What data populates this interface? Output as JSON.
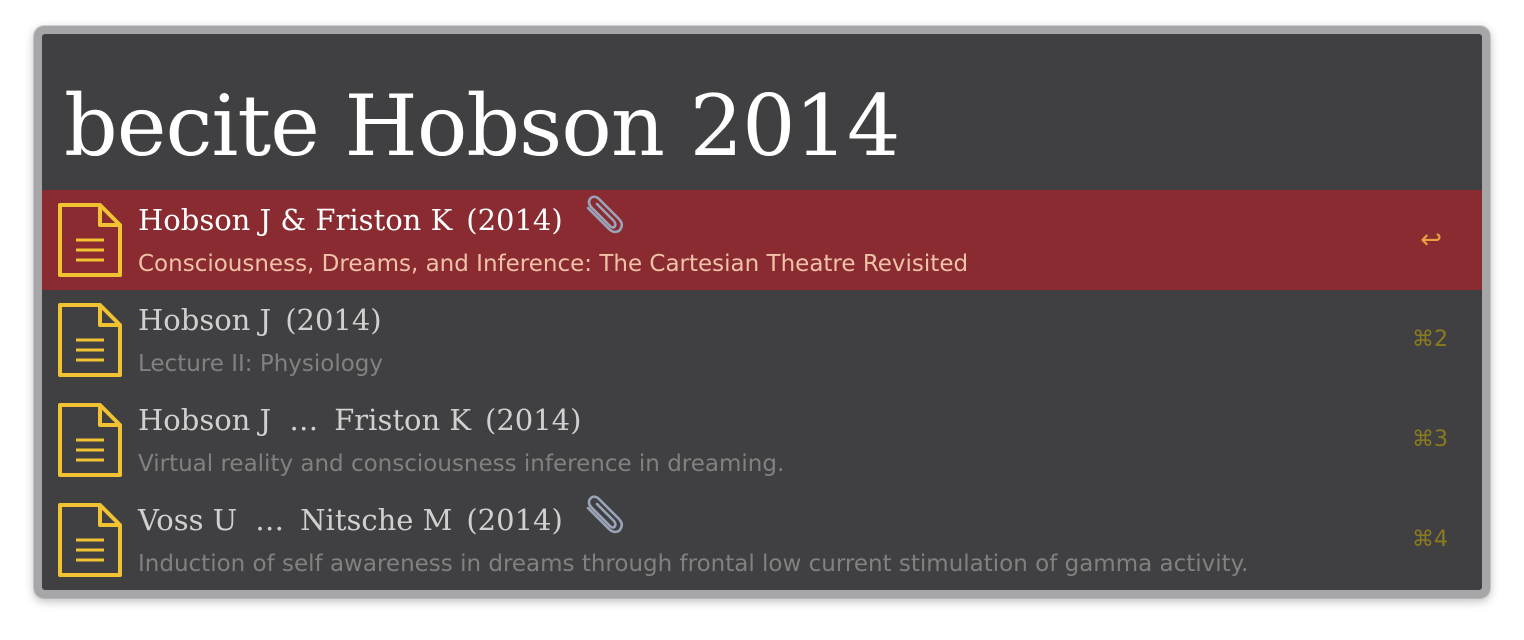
{
  "search": {
    "query": "becite Hobson 2014"
  },
  "colors": {
    "panel_background": "#404042",
    "selected_row": "#892b30",
    "document_icon": "#f1c232",
    "paperclip_icon": "#9aa4b8",
    "shortcut_text": "#8a7b1e",
    "selected_shortcut": "#e8a040"
  },
  "results": [
    {
      "authors": "Hobson J & Friston K",
      "year": "(2014)",
      "title": "Consciousness, Dreams, and Inference: The Cartesian Theatre Revisited",
      "shortcut": "↩",
      "selected": true,
      "icon": "document-icon",
      "attachment_icon": "paperclip-icon"
    },
    {
      "authors": "Hobson J",
      "year": "(2014)",
      "title": "Lecture II: Physiology",
      "shortcut": "⌘2",
      "selected": false,
      "icon": "document-icon"
    },
    {
      "authors": "Hobson J",
      "ellipsis": "…",
      "authors_end": "Friston K",
      "year": "(2014)",
      "title": "Virtual reality and consciousness inference in dreaming.",
      "shortcut": "⌘3",
      "selected": false,
      "icon": "document-icon"
    },
    {
      "authors": "Voss U",
      "ellipsis": "…",
      "authors_end": "Nitsche M",
      "year": "(2014)",
      "title": "Induction of self awareness in dreams through frontal low current stimulation of gamma activity.",
      "shortcut": "⌘4",
      "selected": false,
      "icon": "document-icon",
      "attachment_icon": "paperclip-icon"
    }
  ]
}
